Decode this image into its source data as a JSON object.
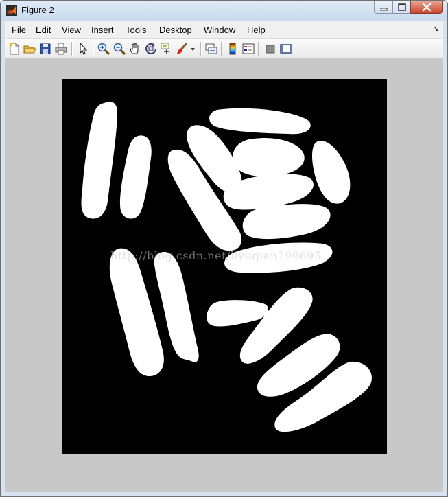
{
  "window": {
    "title": "Figure 2"
  },
  "menu": {
    "items": [
      "File",
      "Edit",
      "View",
      "Insert",
      "Tools",
      "Desktop",
      "Window",
      "Help"
    ],
    "overflow_glyph": "↘"
  },
  "toolbar": {
    "buttons": [
      {
        "name": "new-figure-icon"
      },
      {
        "name": "open-file-icon"
      },
      {
        "name": "save-figure-icon"
      },
      {
        "name": "print-figure-icon"
      },
      {
        "name": "edit-plot-arrow-icon"
      },
      {
        "name": "zoom-in-icon"
      },
      {
        "name": "zoom-out-icon"
      },
      {
        "name": "pan-hand-icon"
      },
      {
        "name": "rotate-3d-icon"
      },
      {
        "name": "data-cursor-icon"
      },
      {
        "name": "brush-icon"
      },
      {
        "name": "brush-dropdown-icon"
      },
      {
        "name": "link-plot-icon"
      },
      {
        "name": "insert-colorbar-icon"
      },
      {
        "name": "insert-legend-icon"
      },
      {
        "name": "hide-plot-tools-icon"
      },
      {
        "name": "show-plot-tools-icon"
      }
    ]
  },
  "image": {
    "watermark": "http://blog.csdn.net/liyuqian199695",
    "background": "#000000",
    "foreground": "#ffffff"
  },
  "colors": {
    "client_background": "#c8c8c8",
    "titlebar": "#c9daee"
  }
}
